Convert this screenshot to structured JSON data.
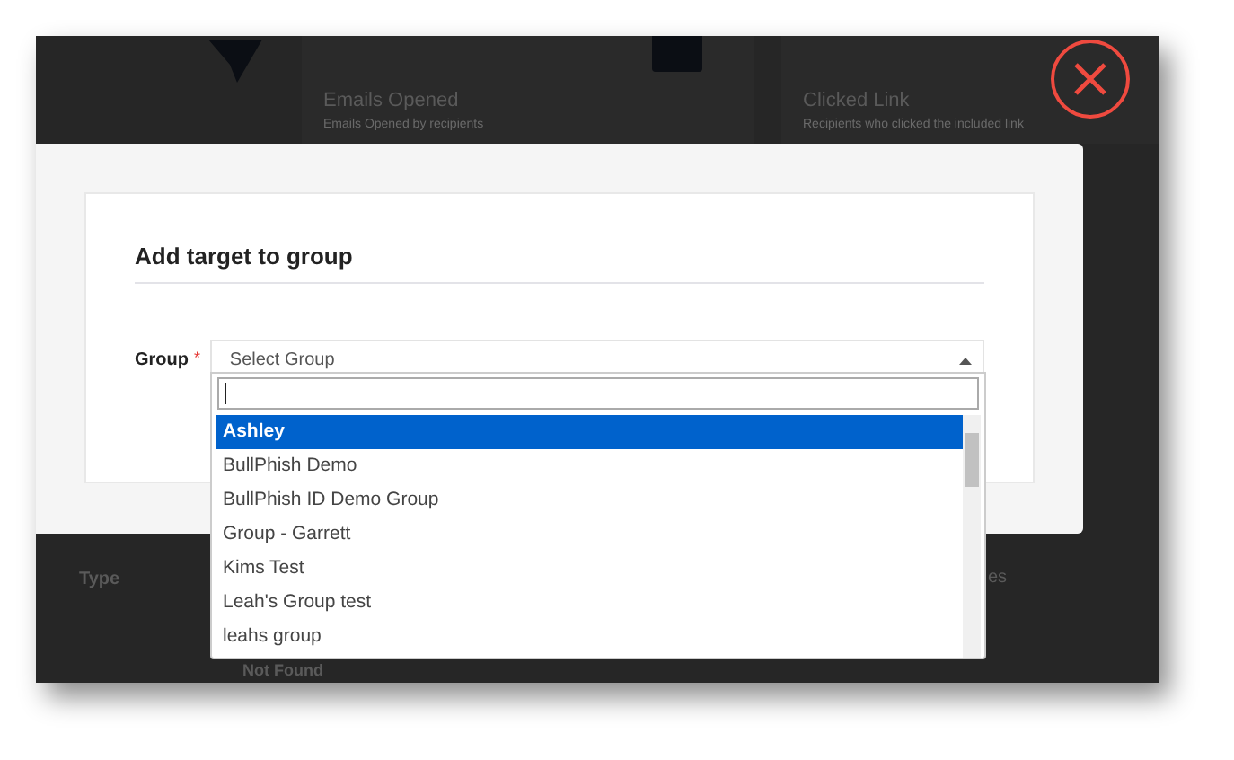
{
  "background": {
    "cards": [
      {
        "title": "Emails Opened",
        "subtitle": "Emails Opened by recipients"
      },
      {
        "title": "Clicked Link",
        "subtitle": "Recipients who clicked the included link"
      }
    ],
    "table": {
      "fragment": "es",
      "header": "Type",
      "cell": "Not Found"
    }
  },
  "modal": {
    "title": "Add target to group",
    "field": {
      "label": "Group",
      "required_mark": "*",
      "placeholder": "Select Group",
      "expanded": true
    },
    "options": [
      {
        "label": "Ashley",
        "selected": true
      },
      {
        "label": "BullPhish Demo",
        "selected": false
      },
      {
        "label": "BullPhish ID Demo Group",
        "selected": false
      },
      {
        "label": "Group - Garrett",
        "selected": false
      },
      {
        "label": "Kims Test",
        "selected": false
      },
      {
        "label": "Leah's Group test",
        "selected": false
      },
      {
        "label": "leahs group",
        "selected": false
      }
    ]
  }
}
